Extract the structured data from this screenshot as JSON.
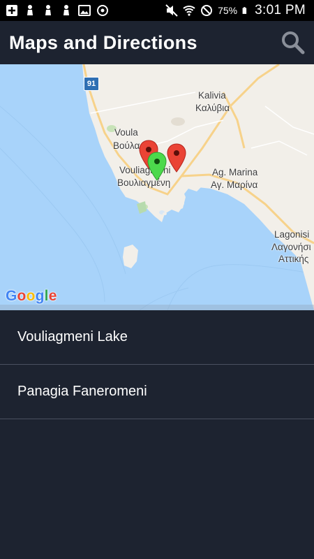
{
  "status_bar": {
    "battery_percent": "75%",
    "time": "3:01 PM",
    "left_icons": [
      "add-box-icon",
      "pawn-icon",
      "pawn-icon",
      "pawn-icon",
      "image-icon",
      "circle-sync-icon"
    ],
    "right_icons": [
      "mute-icon",
      "wifi-icon",
      "do-not-disturb-icon",
      "battery-icon"
    ]
  },
  "app_bar": {
    "title": "Maps and Directions",
    "search_icon": "search-icon"
  },
  "map": {
    "labels": {
      "kalivia_latin": "Kalivia",
      "kalivia_greek": "Καλύβια",
      "voula_latin": "Voula",
      "voula_greek": "Βούλα",
      "vouliagmeni_latin": "Vouliagmeni",
      "vouliagmeni_greek": "Βουλιαγμένη",
      "agmarina_latin": "Ag. Marina",
      "agmarina_greek": "Αγ. Μαρίνα",
      "lagonisi_latin": "Lagonisi",
      "lagonisi_greek": "Λαγονήσι",
      "attiki_greek": "Αττικής"
    },
    "road_shield": "91",
    "attribution": [
      "G",
      "o",
      "o",
      "g",
      "l",
      "e"
    ],
    "colors": {
      "water": "#a8d3fa",
      "land": "#f2efe9",
      "marker_red": "#ea4335",
      "marker_green": "#4cd94c"
    }
  },
  "places": [
    {
      "label": "Vouliagmeni Lake"
    },
    {
      "label": "Panagia Faneromeni"
    }
  ],
  "colors": {
    "background": "#1d2330",
    "divider": "#4a5060"
  }
}
